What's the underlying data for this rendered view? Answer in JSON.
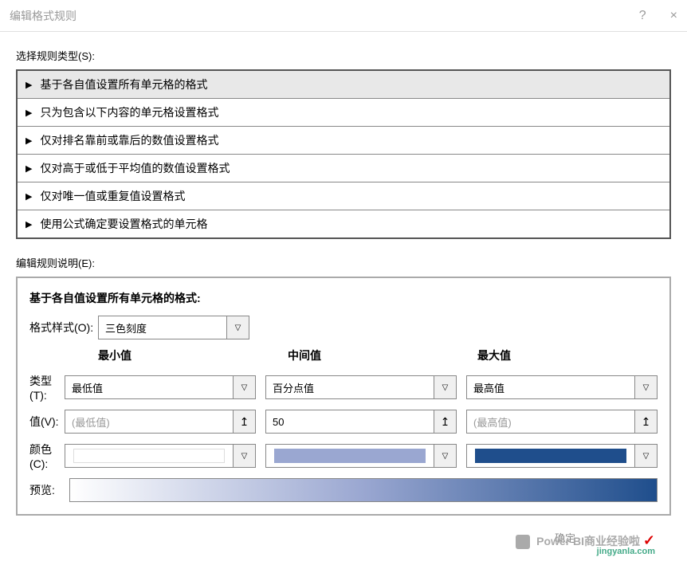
{
  "titlebar": {
    "title": "编辑格式规则",
    "help": "?",
    "close": "×"
  },
  "ruleTypeLabel": "选择规则类型(S):",
  "ruleTypes": [
    "基于各自值设置所有单元格的格式",
    "只为包含以下内容的单元格设置格式",
    "仅对排名靠前或靠后的数值设置格式",
    "仅对高于或低于平均值的数值设置格式",
    "仅对唯一值或重复值设置格式",
    "使用公式确定要设置格式的单元格"
  ],
  "descLabel": "编辑规则说明(E):",
  "descTitle": "基于各自值设置所有单元格的格式:",
  "formatStyleLabel": "格式样式(O):",
  "formatStyleValue": "三色刻度",
  "columns": {
    "min": {
      "header": "最小值",
      "type": "最低值",
      "value": "(最低值)",
      "isPlaceholder": true
    },
    "mid": {
      "header": "中间值",
      "type": "百分点值",
      "value": "50",
      "isPlaceholder": false
    },
    "max": {
      "header": "最大值",
      "type": "最高值",
      "value": "(最高值)",
      "isPlaceholder": true
    }
  },
  "typeLabel": "类型(T):",
  "valueLabel": "值(V):",
  "colorLabel": "颜色(C):",
  "previewLabel": "预览:",
  "watermark1": "Power BI商业经验啦",
  "watermark2": "jingyanla.com",
  "wmBtn": "确定",
  "colors": {
    "min": "#ffffff",
    "mid": "#9aa7d1",
    "max": "#1f4e8c"
  }
}
